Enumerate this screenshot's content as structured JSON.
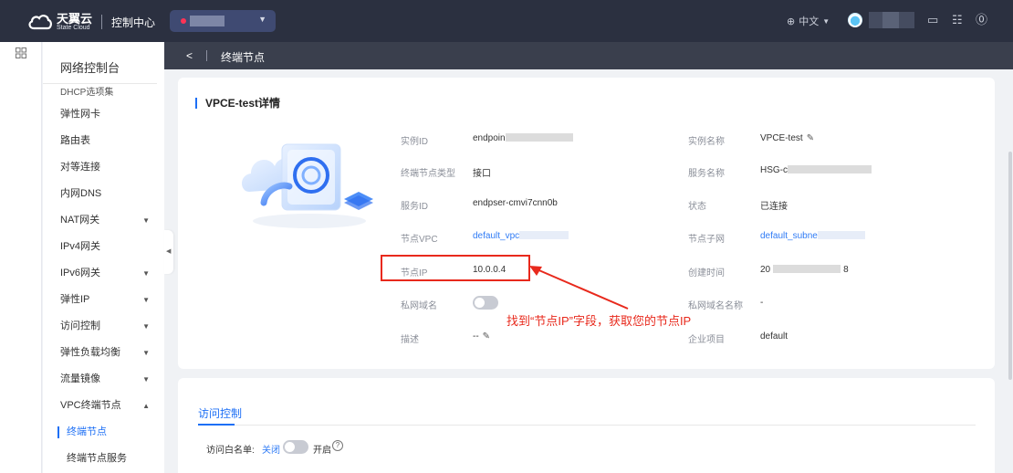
{
  "topbar": {
    "brand_cn": "天翼云",
    "brand_en": "State Cloud",
    "console_title": "控制中心",
    "language": "中文",
    "colors": {
      "bg": "#2b3040",
      "region_pill": "#3f4a72",
      "region_dot": "#ff3355"
    },
    "icons": [
      "ticket-icon",
      "settings-icon",
      "help-icon"
    ]
  },
  "sidebar": {
    "title": "网络控制台",
    "items": [
      {
        "label": "DHCP选项集",
        "caret": ""
      },
      {
        "label": "弹性网卡",
        "caret": ""
      },
      {
        "label": "路由表",
        "caret": ""
      },
      {
        "label": "对等连接",
        "caret": ""
      },
      {
        "label": "内网DNS",
        "caret": ""
      },
      {
        "label": "NAT网关",
        "caret": "▼"
      },
      {
        "label": "IPv4网关",
        "caret": ""
      },
      {
        "label": "IPv6网关",
        "caret": "▼"
      },
      {
        "label": "弹性IP",
        "caret": "▼"
      },
      {
        "label": "访问控制",
        "caret": "▼"
      },
      {
        "label": "弹性负载均衡",
        "caret": "▼"
      },
      {
        "label": "流量镜像",
        "caret": "▼"
      },
      {
        "label": "VPC终端节点",
        "caret": "▲"
      },
      {
        "label": "终端节点",
        "caret": ""
      },
      {
        "label": "终端节点服务",
        "caret": ""
      }
    ],
    "active_item": "终端节点"
  },
  "page_header": {
    "back": "<",
    "title": "终端节点"
  },
  "detail": {
    "title": "VPCE-test详情",
    "fields": {
      "instance_id": {
        "label": "实例ID",
        "value": "endpoin"
      },
      "instance_name": {
        "label": "实例名称",
        "value": "VPCE-test"
      },
      "endpoint_type": {
        "label": "终端节点类型",
        "value": "接口"
      },
      "service_name": {
        "label": "服务名称",
        "value": "HSG-c"
      },
      "service_id": {
        "label": "服务ID",
        "value": "endpser-cmvi7cnn0b"
      },
      "status": {
        "label": "状态",
        "value": "已连接"
      },
      "node_vpc": {
        "label": "节点VPC",
        "value": "default_vpc"
      },
      "node_subnet": {
        "label": "节点子网",
        "value": "default_subne"
      },
      "node_ip": {
        "label": "节点IP",
        "value": "10.0.0.4"
      },
      "created_at": {
        "label": "创建时间",
        "value_prefix": "20",
        "value_suffix": "8"
      },
      "private_domain": {
        "label": "私网域名",
        "toggle_on": false
      },
      "private_domain_name": {
        "label": "私网域名名称",
        "value": "-"
      },
      "description": {
        "label": "描述",
        "value": "--"
      },
      "enterprise_project": {
        "label": "企业项目",
        "value": "default"
      }
    }
  },
  "annotation": {
    "text": "找到“节点IP”字段，获取您的节点IP",
    "color": "#e8291c"
  },
  "access_control": {
    "tab_label": "访问控制",
    "whitelist_label": "访问白名单:",
    "off_label": "关闭",
    "on_label": "开启",
    "toggle_on": false,
    "help_glyph": "?"
  }
}
